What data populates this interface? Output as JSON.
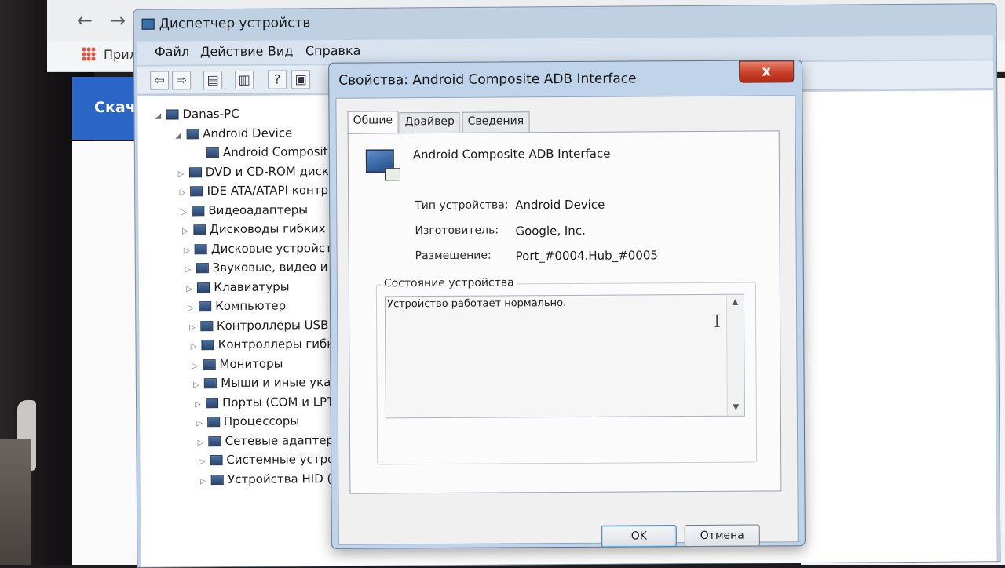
{
  "browser": {
    "back_icon": "←",
    "forward_icon": "→",
    "bookmarks_label": "Прило",
    "banner_text": "Скача"
  },
  "device_manager": {
    "title": "Диспетчер устройств",
    "menu": [
      "Файл",
      "Действие",
      "Вид",
      "Справка"
    ],
    "toolbar_icons": [
      "back-icon",
      "forward-icon",
      "properties-icon",
      "view-icon",
      "help-icon",
      "update-icon"
    ],
    "toolbar_glyphs": [
      "⇦",
      "⇨",
      "▤",
      "▥",
      "?",
      "▣"
    ],
    "tree": [
      {
        "label": "Danas-PC",
        "level": 0,
        "expanded": true
      },
      {
        "label": "Android Device",
        "level": 1,
        "expanded": true
      },
      {
        "label": "Android Composit",
        "level": 2,
        "expanded": null
      },
      {
        "label": "DVD и CD-ROM диско",
        "level": 1,
        "expanded": false
      },
      {
        "label": "IDE ATA/ATAPI контр",
        "level": 1,
        "expanded": false
      },
      {
        "label": "Видеоадаптеры",
        "level": 1,
        "expanded": false
      },
      {
        "label": "Дисководы гибких ди",
        "level": 1,
        "expanded": false
      },
      {
        "label": "Дисковые устройства",
        "level": 1,
        "expanded": false
      },
      {
        "label": "Звуковые, видео и иг",
        "level": 1,
        "expanded": false
      },
      {
        "label": "Клавиатуры",
        "level": 1,
        "expanded": false
      },
      {
        "label": "Компьютер",
        "level": 1,
        "expanded": false
      },
      {
        "label": "Контроллеры USB",
        "level": 1,
        "expanded": false
      },
      {
        "label": "Контроллеры гибких",
        "level": 1,
        "expanded": false
      },
      {
        "label": "Мониторы",
        "level": 1,
        "expanded": false
      },
      {
        "label": "Мыши и иные указы",
        "level": 1,
        "expanded": false
      },
      {
        "label": "Порты (COM и LPT)",
        "level": 1,
        "expanded": false
      },
      {
        "label": "Процессоры",
        "level": 1,
        "expanded": false
      },
      {
        "label": "Сетевые адаптеры",
        "level": 1,
        "expanded": false
      },
      {
        "label": "Системные устройст",
        "level": 1,
        "expanded": false
      },
      {
        "label": "Устройства HID (Hum",
        "level": 1,
        "expanded": false
      }
    ]
  },
  "dialog": {
    "title": "Свойства: Android Composite ADB Interface",
    "close_label": "x",
    "tabs": [
      {
        "label": "Общие",
        "active": true
      },
      {
        "label": "Драйвер",
        "active": false
      },
      {
        "label": "Сведения",
        "active": false
      }
    ],
    "device_name": "Android Composite ADB Interface",
    "properties": [
      {
        "label": "Тип устройства:",
        "value": "Android Device"
      },
      {
        "label": "Изготовитель:",
        "value": "Google, Inc."
      },
      {
        "label": "Размещение:",
        "value": "Port_#0004.Hub_#0005"
      }
    ],
    "status_group_label": "Состояние устройства",
    "status_text": "Устройство работает нормально.",
    "ok_label": "OK",
    "cancel_label": "Отмена"
  }
}
